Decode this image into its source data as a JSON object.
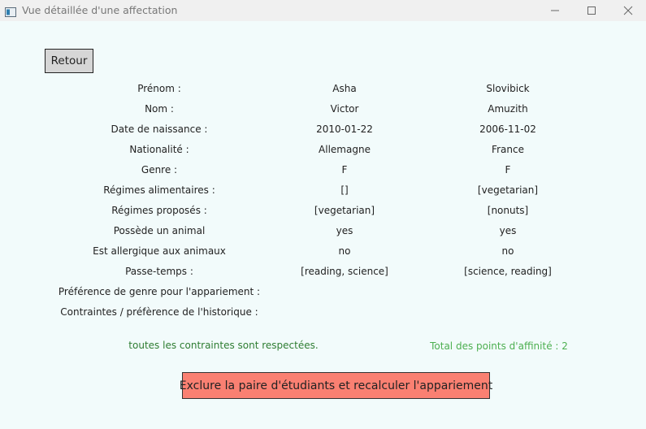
{
  "window": {
    "title": "Vue détaillée d'une affectation",
    "app_icon": "window-app-icon",
    "controls": [
      "minimize-icon",
      "maximize-icon",
      "close-icon"
    ]
  },
  "back_button": {
    "label": "Retour"
  },
  "rows": [
    {
      "label": "Prénom :",
      "student1": "Asha",
      "student2": "Slovibick"
    },
    {
      "label": "Nom :",
      "student1": "Victor",
      "student2": "Amuzith"
    },
    {
      "label": "Date de naissance :",
      "student1": "2010-01-22",
      "student2": "2006-11-02"
    },
    {
      "label": "Nationalité :",
      "student1": "Allemagne",
      "student2": "France"
    },
    {
      "label": "Genre :",
      "student1": "F",
      "student2": "F"
    },
    {
      "label": "Régimes alimentaires :",
      "student1": "[]",
      "student2": "[vegetarian]"
    },
    {
      "label": "Régimes proposés :",
      "student1": "[vegetarian]",
      "student2": "[nonuts]"
    },
    {
      "label": "Possède un animal",
      "student1": "yes",
      "student2": "yes"
    },
    {
      "label": "Est allergique aux animaux",
      "student1": "no",
      "student2": "no"
    },
    {
      "label": "Passe-temps :",
      "student1": "[reading, science]",
      "student2": "[science, reading]"
    },
    {
      "label": "Préférence de genre pour l'appariement :",
      "student1": "",
      "student2": ""
    },
    {
      "label": "Contraintes / préfèrence de l'historique :",
      "student1": "",
      "student2": ""
    }
  ],
  "status": {
    "constraints": "toutes les contraintes sont respectées.",
    "affinity": "Total des points d'affinité : 2",
    "colors": {
      "ok": "#2e7d32",
      "affinity": "#4caf50"
    }
  },
  "exclude_button": {
    "label": "Exclure la paire d'étudiants et recalculer l'appariement",
    "color": "#fa8072"
  }
}
